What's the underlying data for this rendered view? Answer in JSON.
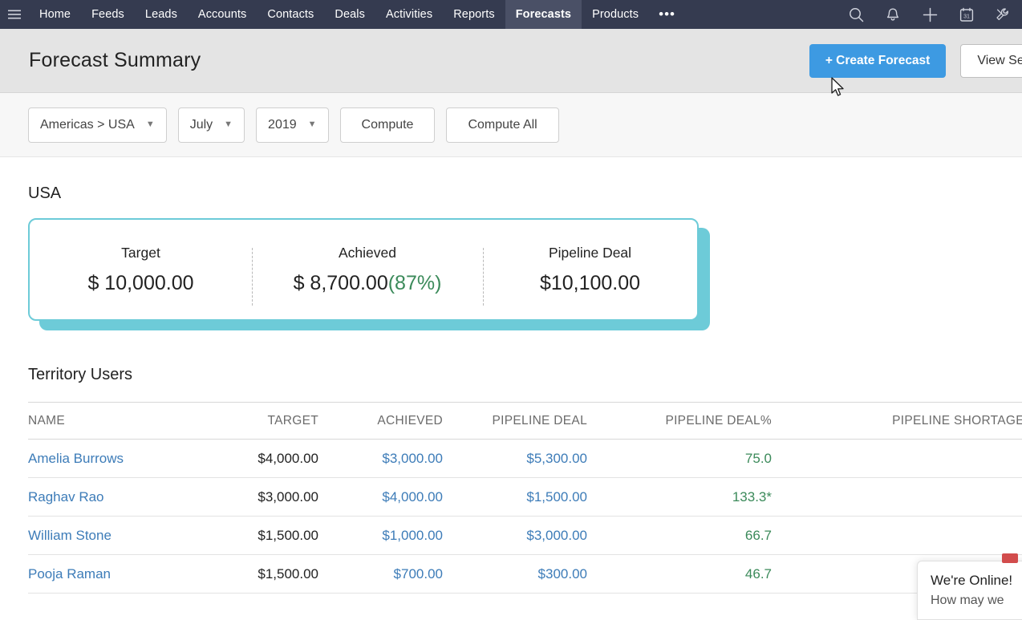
{
  "nav": {
    "menu_icon": "hamburger-menu-icon",
    "items": [
      {
        "label": "Home",
        "active": false
      },
      {
        "label": "Feeds",
        "active": false
      },
      {
        "label": "Leads",
        "active": false
      },
      {
        "label": "Accounts",
        "active": false
      },
      {
        "label": "Contacts",
        "active": false
      },
      {
        "label": "Deals",
        "active": false
      },
      {
        "label": "Activities",
        "active": false
      },
      {
        "label": "Reports",
        "active": false
      },
      {
        "label": "Forecasts",
        "active": true
      },
      {
        "label": "Products",
        "active": false
      }
    ],
    "overflow_label": "•••",
    "icons": [
      "search-icon",
      "notification-bell-icon",
      "add-plus-icon",
      "calendar-icon",
      "tools-wrench-icon"
    ],
    "calendar_day": "31",
    "background_color": "#353B50",
    "active_tab_color": "#4A5066"
  },
  "header": {
    "title": "Forecast Summary",
    "create_button": "+ Create Forecast",
    "settings_button": "View Settings",
    "primary_color": "#3D9AE2"
  },
  "filters": {
    "territory": "Americas > USA",
    "month": "July",
    "year": "2019",
    "compute_button": "Compute",
    "compute_all_button": "Compute All"
  },
  "summary": {
    "region_title": "USA",
    "accent_color": "#6DCBD8",
    "metrics": [
      {
        "label": "Target",
        "value": "$ 10,000.00",
        "pct": ""
      },
      {
        "label": "Achieved",
        "value": "$ 8,700.00",
        "pct": "(87%)"
      },
      {
        "label": "Pipeline Deal",
        "value": "$10,100.00",
        "pct": ""
      }
    ]
  },
  "table": {
    "title": "Territory Users",
    "columns": [
      "NAME",
      "TARGET",
      "ACHIEVED",
      "PIPELINE DEAL",
      "PIPELINE DEAL%",
      "PIPELINE SHORTAGE%"
    ],
    "rows": [
      {
        "name": "Amelia Burrows",
        "target": "$4,000.00",
        "achieved": "$3,000.00",
        "pipeline_deal": "$5,300.00",
        "pipeline_deal_pct": "75.0",
        "pipeline_shortage_pct": "-"
      },
      {
        "name": "Raghav Rao",
        "target": "$3,000.00",
        "achieved": "$4,000.00",
        "pipeline_deal": "$1,500.00",
        "pipeline_deal_pct": "133.3*",
        "pipeline_shortage_pct": "-"
      },
      {
        "name": "William Stone",
        "target": "$1,500.00",
        "achieved": "$1,000.00",
        "pipeline_deal": "$3,000.00",
        "pipeline_deal_pct": "66.7",
        "pipeline_shortage_pct": "-"
      },
      {
        "name": "Pooja Raman",
        "target": "$1,500.00",
        "achieved": "$700.00",
        "pipeline_deal": "$300.00",
        "pipeline_deal_pct": "46.7",
        "pipeline_shortage_pct": "-"
      }
    ],
    "link_color": "#3D7CB8",
    "positive_color": "#3B8A5A"
  },
  "chat": {
    "title": "We're Online!",
    "subtitle": "How may we"
  }
}
